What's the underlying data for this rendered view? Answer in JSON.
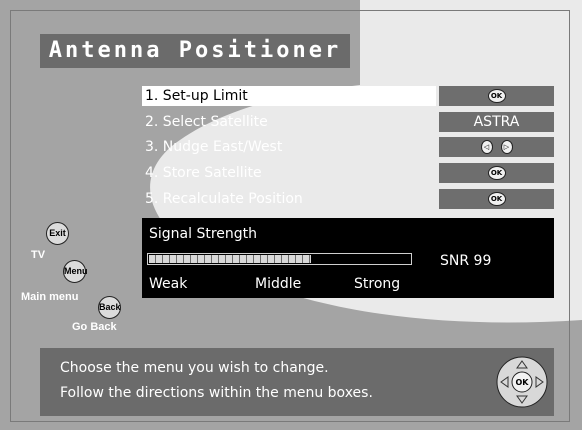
{
  "title": "Antenna Positioner",
  "menu": {
    "items": [
      {
        "label": "1. Set-up Limit",
        "control": "ok",
        "selected": true
      },
      {
        "label": "2. Select Satellite",
        "control": "value",
        "value": "ASTRA"
      },
      {
        "label": "3. Nudge East/West",
        "control": "arrows"
      },
      {
        "label": "4. Store Satellite",
        "control": "ok"
      },
      {
        "label": "5. Recalculate Position",
        "control": "ok"
      }
    ]
  },
  "buttons": {
    "ok": "OK"
  },
  "signal": {
    "title": "Signal Strength",
    "snr": "SNR 99",
    "level": 0.62,
    "scale": [
      "Weak",
      "Middle",
      "Strong"
    ]
  },
  "side_buttons": [
    {
      "button": "Exit",
      "caption": "TV"
    },
    {
      "button": "Menu",
      "caption": "Main menu"
    },
    {
      "button": "Back",
      "caption": "Go Back"
    }
  ],
  "help": {
    "line1": "Choose the menu you wish to change.",
    "line2": "Follow the directions within the menu boxes."
  },
  "colors": {
    "background": "#a4a4a4",
    "swoosh": "#eaeaea",
    "panel": "#6b6b6b",
    "signal_panel": "#000000",
    "selection": "#ffffff"
  }
}
